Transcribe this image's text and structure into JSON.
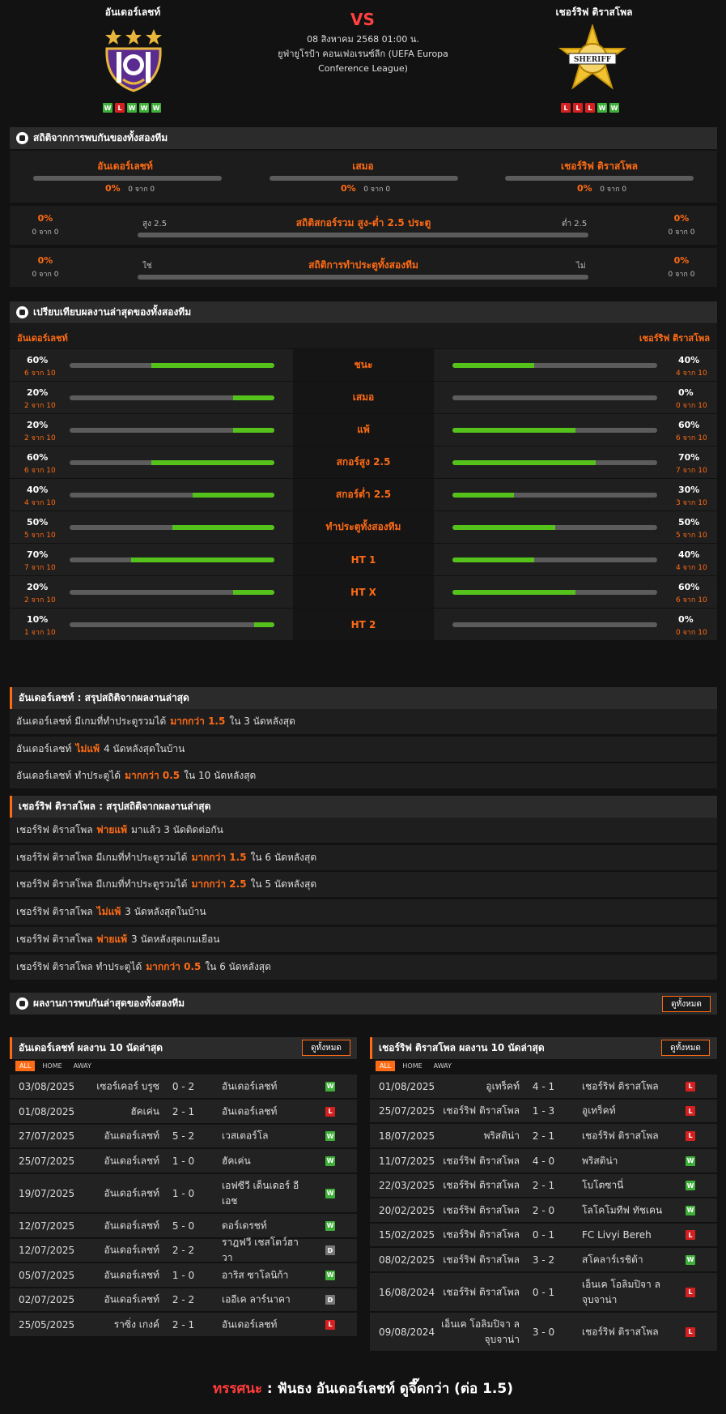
{
  "match": {
    "home": "อันเดอร์เลชท์",
    "away": "เชอร์ริฟ ติราสโพล",
    "vs": "VS",
    "datetime": "08 สิงหาคม 2568 01:00 น.",
    "competition": "ยูฟ่ายูโรป้า คอนเฟอเรนซ์ลีก (UEFA Europa Conference League)",
    "home_form": [
      "W",
      "L",
      "W",
      "W",
      "W"
    ],
    "away_form": [
      "L",
      "L",
      "L",
      "W",
      "W"
    ]
  },
  "h2h": {
    "title": "สถิติจากการพบกันของทั้งสองทีม",
    "cols": [
      {
        "label": "อันเดอร์เลชท์",
        "pct": "0%",
        "count": "0 จาก 0"
      },
      {
        "label": "เสมอ",
        "pct": "0%",
        "count": "0 จาก 0"
      },
      {
        "label": "เชอร์ริฟ ติราสโพล",
        "pct": "0%",
        "count": "0 จาก 0"
      }
    ],
    "ou": {
      "title": "สถิติสกอร์รวม สูง-ต่ำ 2.5 ประตู",
      "left_label": "สูง 2.5",
      "right_label": "ต่ำ 2.5",
      "left_pct": "0%",
      "left_count": "0 จาก 0",
      "right_pct": "0%",
      "right_count": "0 จาก 0"
    },
    "btts": {
      "title": "สถิติการทำประตูทั้งสองทีม",
      "left_label": "ใช่",
      "right_label": "ไม่",
      "left_pct": "0%",
      "left_count": "0 จาก 0",
      "right_pct": "0%",
      "right_count": "0 จาก 0"
    }
  },
  "compare": {
    "title": "เปรียบเทียบผลงานล่าสุดของทั้งสองทีม",
    "home": "อันเดอร์เลชท์",
    "away": "เชอร์ริฟ ติราสโพล",
    "rows": [
      {
        "label": "ชนะ",
        "hp": "60%",
        "hc": "6 จาก 10",
        "hv": 0.6,
        "ap": "40%",
        "ac": "4 จาก 10",
        "av": 0.4
      },
      {
        "label": "เสมอ",
        "hp": "20%",
        "hc": "2 จาก 10",
        "hv": 0.2,
        "ap": "0%",
        "ac": "0 จาก 10",
        "av": 0
      },
      {
        "label": "แพ้",
        "hp": "20%",
        "hc": "2 จาก 10",
        "hv": 0.2,
        "ap": "60%",
        "ac": "6 จาก 10",
        "av": 0.6
      },
      {
        "label": "สกอร์สูง 2.5",
        "hp": "60%",
        "hc": "6 จาก 10",
        "hv": 0.6,
        "ap": "70%",
        "ac": "7 จาก 10",
        "av": 0.7
      },
      {
        "label": "สกอร์ต่ำ 2.5",
        "hp": "40%",
        "hc": "4 จาก 10",
        "hv": 0.4,
        "ap": "30%",
        "ac": "3 จาก 10",
        "av": 0.3
      },
      {
        "label": "ทำประตูทั้งสองทีม",
        "hp": "50%",
        "hc": "5 จาก 10",
        "hv": 0.5,
        "ap": "50%",
        "ac": "5 จาก 10",
        "av": 0.5
      },
      {
        "label": "HT 1",
        "hp": "70%",
        "hc": "7 จาก 10",
        "hv": 0.7,
        "ap": "40%",
        "ac": "4 จาก 10",
        "av": 0.4
      },
      {
        "label": "HT X",
        "hp": "20%",
        "hc": "2 จาก 10",
        "hv": 0.2,
        "ap": "60%",
        "ac": "6 จาก 10",
        "av": 0.6
      },
      {
        "label": "HT 2",
        "hp": "10%",
        "hc": "1 จาก 10",
        "hv": 0.1,
        "ap": "0%",
        "ac": "0 จาก 10",
        "av": 0
      }
    ]
  },
  "home_summary": {
    "title": "อันเดอร์เลชท์ : สรุปสถิติจากผลงานล่าสุด",
    "lines": [
      [
        "อันเดอร์เลชท์  มีเกมที่ทำประตูรวมได้",
        "มากกว่า  1.5",
        "ใน 3 นัดหลังสุด"
      ],
      [
        "อันเดอร์เลชท์",
        "ไม่แพ้",
        "4  นัดหลังสุดในบ้าน"
      ],
      [
        "อันเดอร์เลชท์  ทำประตูได้",
        "มากกว่า  0.5",
        "ใน 10 นัดหลังสุด"
      ]
    ]
  },
  "away_summary": {
    "title": "เชอร์ริฟ ติราสโพล : สรุปสถิติจากผลงานล่าสุด",
    "lines": [
      [
        "เชอร์ริฟ ติราสโพล",
        "พ่ายแพ้",
        "มาแล้ว 3 นัดติดต่อกัน"
      ],
      [
        "เชอร์ริฟ ติราสโพล  มีเกมที่ทำประตูรวมได้",
        "มากกว่า  1.5",
        "ใน 6 นัดหลังสุด"
      ],
      [
        "เชอร์ริฟ ติราสโพล  มีเกมที่ทำประตูรวมได้",
        "มากกว่า  2.5",
        "ใน 5 นัดหลังสุด"
      ],
      [
        "เชอร์ริฟ ติราสโพล",
        "ไม่แพ้",
        "3  นัดหลังสุดในบ้าน"
      ],
      [
        "เชอร์ริฟ ติราสโพล",
        "พ่ายแพ้",
        "3  นัดหลังสุดเกมเยือน"
      ],
      [
        "เชอร์ริฟ ติราสโพล  ทำประตูได้",
        "มากกว่า  0.5",
        "ใน 6 นัดหลังสุด"
      ]
    ]
  },
  "recent": {
    "title": "ผลงานการพบกันล่าสุดของทั้งสองทีม",
    "view_all": "ดูทั้งหมด",
    "tabs": [
      "ALL",
      "HOME",
      "AWAY"
    ],
    "home_title": "อันเดอร์เลชท์ ผลงาน 10 นัดล่าสุด",
    "away_title": "เชอร์ริฟ ติราสโพล ผลงาน 10 นัดล่าสุด",
    "home_rows": [
      [
        "03/08/2025",
        "เซอร์เคอร์ บรูซ",
        "0 - 2",
        "อันเดอร์เลชท์",
        "W"
      ],
      [
        "01/08/2025",
        "ฮัคเค่น",
        "2 - 1",
        "อันเดอร์เลชท์",
        "L"
      ],
      [
        "27/07/2025",
        "อันเดอร์เลชท์",
        "5 - 2",
        "เวสเตอร์โล",
        "W"
      ],
      [
        "25/07/2025",
        "อันเดอร์เลชท์",
        "1 - 0",
        "ฮัคเค่น",
        "W"
      ],
      [
        "19/07/2025",
        "อันเดอร์เลชท์",
        "1 - 0",
        "เอฟซีวี เด็นเดอร์ อี เอช",
        "W"
      ],
      [
        "12/07/2025",
        "อันเดอร์เลชท์",
        "5 - 0",
        "ดอร์เดรชท์",
        "W"
      ],
      [
        "12/07/2025",
        "อันเดอร์เลชท์",
        "2 - 2",
        "ราฎฟวี เชสโตว์ฮาวา",
        "D"
      ],
      [
        "05/07/2025",
        "อันเดอร์เลชท์",
        "1 - 0",
        "อาริส ซาโลนิก้า",
        "W"
      ],
      [
        "02/07/2025",
        "อันเดอร์เลชท์",
        "2 - 2",
        "เออีเค ลาร์นาคา",
        "D"
      ],
      [
        "25/05/2025",
        "ราซิ่ง เกงค์",
        "2 - 1",
        "อันเดอร์เลชท์",
        "L"
      ]
    ],
    "away_rows": [
      [
        "01/08/2025",
        "อูเทร็คท์",
        "4 - 1",
        "เชอร์ริฟ ติราสโพล",
        "L"
      ],
      [
        "25/07/2025",
        "เชอร์ริฟ ติราสโพล",
        "1 - 3",
        "อูเทร็คท์",
        "L"
      ],
      [
        "18/07/2025",
        "พริสติน่า",
        "2 - 1",
        "เชอร์ริฟ ติราสโพล",
        "L"
      ],
      [
        "11/07/2025",
        "เชอร์ริฟ ติราสโพล",
        "4 - 0",
        "พริสติน่า",
        "W"
      ],
      [
        "22/03/2025",
        "เชอร์ริฟ ติราสโพล",
        "2 - 1",
        "โบโตซานี่",
        "W"
      ],
      [
        "20/02/2025",
        "เชอร์ริฟ ติราสโพล",
        "2 - 0",
        "โลโคโมทีฟ ทัชเคน",
        "W"
      ],
      [
        "15/02/2025",
        "เชอร์ริฟ ติราสโพล",
        "0 - 1",
        "FC Livyi Bereh",
        "L"
      ],
      [
        "08/02/2025",
        "เชอร์ริฟ ติราสโพล",
        "3 - 2",
        "สโคลาร์เรชิต้า",
        "W"
      ],
      [
        "16/08/2024",
        "เชอร์ริฟ ติราสโพล",
        "0 - 1",
        "เอ็นเค โอลิมปิจา ลจุบจาน่า",
        "L"
      ],
      [
        "09/08/2024",
        "เอ็นเค โอลิมปิจา ลจุบจาน่า",
        "3 - 0",
        "เชอร์ริฟ ติราสโพล",
        "L"
      ]
    ]
  },
  "verdict": {
    "label": "ทรรศนะ",
    "sep": " : ",
    "text": "ฟันธง อันเดอร์เลชท์ ดูจึ๊ดกว่า (ต่อ 1.5)"
  },
  "colors": {
    "accent": "#ff6b14",
    "win": "#3fb03a",
    "loss": "#d42020",
    "draw": "#777777",
    "bar": "#55c21c"
  }
}
